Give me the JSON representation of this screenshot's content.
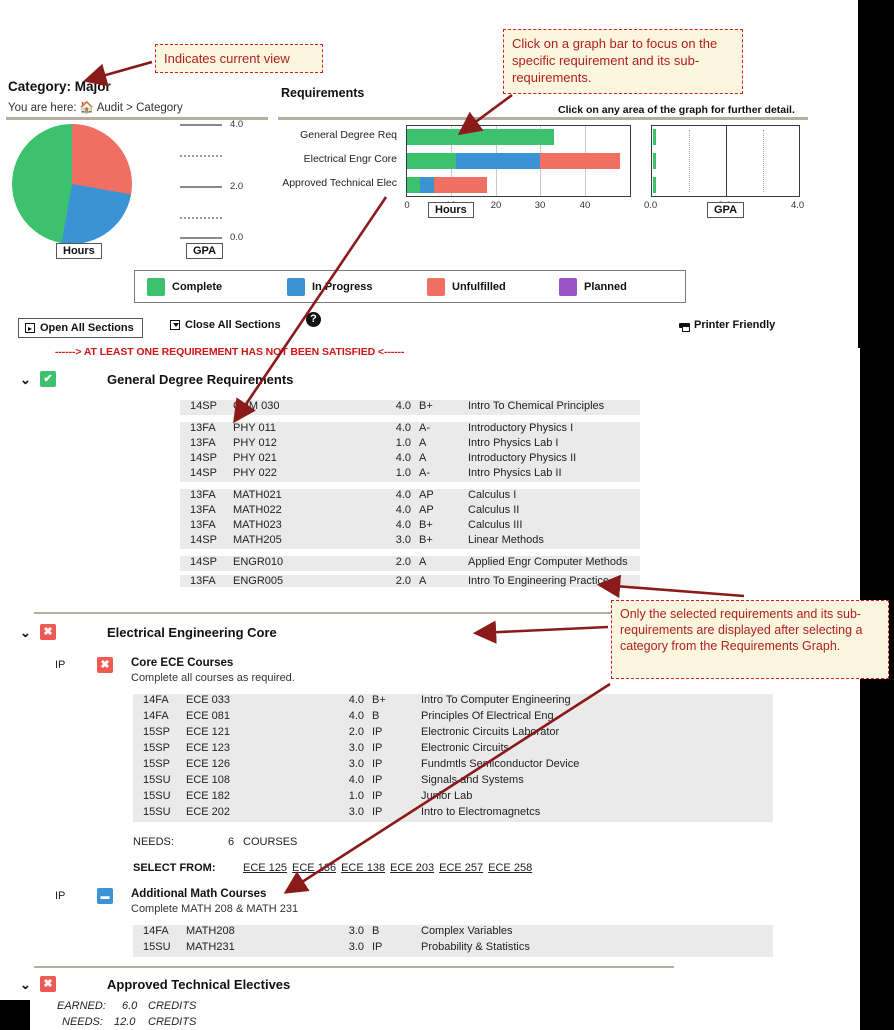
{
  "header": {
    "category_title": "Category: Major",
    "breadcrumb_prefix": "You are here:",
    "breadcrumb_home": "Audit",
    "breadcrumb_sep": ">",
    "breadcrumb_current": "Category",
    "requirements_title": "Requirements",
    "click_hint": "Click on any area of the graph for further detail."
  },
  "left_charts": {
    "hours_label": "Hours",
    "gpa_label": "GPA",
    "gpa_ticks": [
      "4.0",
      "2.0",
      "0.0"
    ]
  },
  "chart_data": [
    {
      "type": "pie",
      "title": "Hours",
      "labels": [
        "Complete",
        "In Progress",
        "Unfulfilled"
      ],
      "values": [
        47.2,
        25.0,
        27.8
      ],
      "colors": [
        "#3cc16e",
        "#3b93d6",
        "#ef6f63"
      ],
      "legend": "shared"
    },
    {
      "type": "bar",
      "orientation": "horizontal",
      "stacked": true,
      "title": "Requirements",
      "xlabel": "Hours",
      "ylabel": "",
      "xlim": [
        0,
        50
      ],
      "xticks": [
        0,
        10,
        20,
        30,
        40
      ],
      "grid": true,
      "categories": [
        "General Degree Req",
        "Electrical Engr Core",
        "Approved Technical Elec"
      ],
      "series": [
        {
          "name": "Complete",
          "color": "#3cc16e",
          "values": [
            33,
            11,
            3
          ]
        },
        {
          "name": "In Progress",
          "color": "#3b93d6",
          "values": [
            0,
            19,
            3
          ]
        },
        {
          "name": "Unfulfilled",
          "color": "#ef6f63",
          "values": [
            0,
            18,
            12
          ]
        },
        {
          "name": "Planned",
          "color": "#9b54c4",
          "values": [
            0,
            0,
            0
          ]
        }
      ]
    },
    {
      "type": "bar",
      "orientation": "horizontal",
      "title": "GPA",
      "xlabel": "GPA",
      "xlim": [
        0,
        4
      ],
      "xticks": [
        "0.0",
        "2.0",
        "4.0"
      ],
      "categories": [
        "General Degree Req",
        "Electrical Engr Core",
        "Approved Technical Elec"
      ],
      "series": [
        {
          "name": "GPA",
          "color": "#3cc16e",
          "values": [
            0.06,
            0.04,
            0.05
          ]
        }
      ]
    }
  ],
  "legend": {
    "items": [
      {
        "label": "Complete",
        "color": "#3cc16e"
      },
      {
        "label": "In Progress",
        "color": "#3b93d6"
      },
      {
        "label": "Unfulfilled",
        "color": "#ef6f63"
      },
      {
        "label": "Planned",
        "color": "#9b54c4"
      }
    ]
  },
  "toolbar": {
    "open_all": "Open All Sections",
    "close_all": "Close All Sections",
    "help": "?",
    "printer_friendly": "Printer Friendly",
    "warning": "------> AT LEAST ONE REQUIREMENT HAS NOT BEEN SATISFIED <------"
  },
  "sections": [
    {
      "name": "General Degree Requirements",
      "status_icon": "check",
      "status_glyph": "✔",
      "chevron": "⌄",
      "courses": [
        {
          "term": "14SP",
          "code": "CHM 030",
          "credits": "4.0",
          "grade": "B+",
          "title": "Intro To Chemical Principles"
        },
        {
          "term": "13FA",
          "code": "PHY 011",
          "credits": "4.0",
          "grade": "A-",
          "title": "Introductory Physics I"
        },
        {
          "term": "13FA",
          "code": "PHY 012",
          "credits": "1.0",
          "grade": "A",
          "title": "Intro Physics Lab I"
        },
        {
          "term": "14SP",
          "code": "PHY 021",
          "credits": "4.0",
          "grade": "A",
          "title": "Introductory Physics II"
        },
        {
          "term": "14SP",
          "code": "PHY 022",
          "credits": "1.0",
          "grade": "A-",
          "title": "Intro Physics Lab II"
        },
        {
          "term": "13FA",
          "code": "MATH021",
          "credits": "4.0",
          "grade": "AP",
          "title": "Calculus I"
        },
        {
          "term": "13FA",
          "code": "MATH022",
          "credits": "4.0",
          "grade": "AP",
          "title": "Calculus II"
        },
        {
          "term": "13FA",
          "code": "MATH023",
          "credits": "4.0",
          "grade": "B+",
          "title": "Calculus III"
        },
        {
          "term": "14SP",
          "code": "MATH205",
          "credits": "3.0",
          "grade": "B+",
          "title": "Linear Methods"
        },
        {
          "term": "14SP",
          "code": "ENGR010",
          "credits": "2.0",
          "grade": "A",
          "title": "Applied Engr Computer Methods"
        },
        {
          "term": "13FA",
          "code": "ENGR005",
          "credits": "2.0",
          "grade": "A",
          "title": "Intro To Engineering Practice"
        }
      ]
    },
    {
      "name": "Electrical Engineering Core",
      "status_icon": "cross",
      "status_glyph": "✖",
      "chevron": "⌄",
      "subrequirements": [
        {
          "flag": "IP",
          "status_icon": "cross",
          "status_glyph": "✖",
          "title": "Core ECE Courses",
          "description": "Complete all courses as required.",
          "courses": [
            {
              "term": "14FA",
              "code": "ECE 033",
              "credits": "4.0",
              "grade": "B+",
              "title": "Intro To Computer Engineering"
            },
            {
              "term": "14FA",
              "code": "ECE 081",
              "credits": "4.0",
              "grade": "B",
              "title": "Principles Of Electrical Eng"
            },
            {
              "term": "15SP",
              "code": "ECE 121",
              "credits": "2.0",
              "grade": "IP",
              "title": "Electronic Circuits Laborator"
            },
            {
              "term": "15SP",
              "code": "ECE 123",
              "credits": "3.0",
              "grade": "IP",
              "title": "Electronic Circuits"
            },
            {
              "term": "15SP",
              "code": "ECE 126",
              "credits": "3.0",
              "grade": "IP",
              "title": "Fundmtls Semiconductor Device"
            },
            {
              "term": "15SU",
              "code": "ECE 108",
              "credits": "4.0",
              "grade": "IP",
              "title": "Signals and Systems"
            },
            {
              "term": "15SU",
              "code": "ECE 182",
              "credits": "1.0",
              "grade": "IP",
              "title": "Junior Lab"
            },
            {
              "term": "15SU",
              "code": "ECE 202",
              "credits": "3.0",
              "grade": "IP",
              "title": "Intro to Electromagnetcs"
            }
          ],
          "needs_label": "NEEDS:",
          "needs_count": "6",
          "needs_unit": "COURSES",
          "select_label": "SELECT FROM:",
          "select_options": [
            "ECE 125",
            "ECE 136",
            "ECE 138",
            "ECE 203",
            "ECE 257",
            "ECE 258"
          ]
        },
        {
          "flag": "IP",
          "status_icon": "dash",
          "status_glyph": "▬",
          "title": "Additional Math Courses",
          "description": "Complete MATH 208 & MATH 231",
          "courses": [
            {
              "term": "14FA",
              "code": "MATH208",
              "credits": "3.0",
              "grade": "B",
              "title": "Complex Variables"
            },
            {
              "term": "15SU",
              "code": "MATH231",
              "credits": "3.0",
              "grade": "IP",
              "title": "Probability & Statistics"
            }
          ]
        }
      ]
    },
    {
      "name": "Approved Technical Electives",
      "status_icon": "cross",
      "status_glyph": "✖",
      "chevron": "⌄",
      "earned_label": "EARNED:",
      "earned_value": "6.0",
      "earned_unit": "CREDITS",
      "needs_label": "NEEDS:",
      "needs_value": "12.0",
      "needs_unit": "CREDITS"
    }
  ],
  "callouts": [
    {
      "id": "co1",
      "text": "Indicates current view"
    },
    {
      "id": "co2",
      "text": "Click on a graph bar to focus on the specific requirement and its sub-requirements."
    },
    {
      "id": "co3",
      "text": "Only the selected requirements and its sub-requirements are displayed after selecting a category from the Requirements Graph."
    }
  ],
  "colors": {
    "complete": "#3cc16e",
    "in_progress": "#3b93d6",
    "unfulfilled": "#ef6f63",
    "planned": "#9b54c4",
    "warning": "#d01515",
    "callout_bg": "#fdf6df",
    "callout_border": "#cc2222",
    "rule": "#b7ada0"
  }
}
